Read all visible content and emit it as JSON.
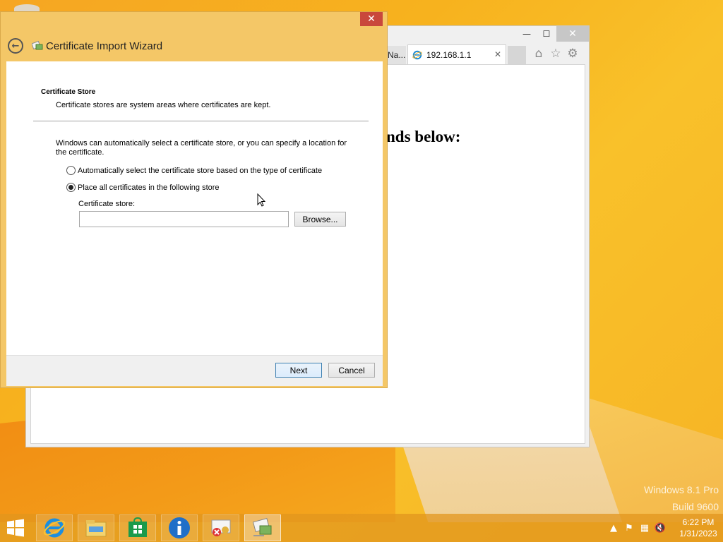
{
  "desktop": {
    "watermark_line1": "Windows 8.1 Pro",
    "watermark_line2": "Build 9600"
  },
  "browser": {
    "minimize": "—",
    "maximize": "☐",
    "close": "✕",
    "tab_prev_label": "Na...",
    "tab_active_label": "192.168.1.1",
    "tab_close": "✕",
    "page_heading_fragment": "nds below:"
  },
  "wizard": {
    "title": "Certificate Import Wizard",
    "close": "✕",
    "section_title": "Certificate Store",
    "section_desc": "Certificate stores are system areas where certificates are kept.",
    "intro": "Windows can automatically select a certificate store, or you can specify a location for the certificate.",
    "option_auto": "Automatically select the certificate store based on the type of certificate",
    "option_manual": "Place all certificates in the following store",
    "selected_option": "manual",
    "store_label": "Certificate store:",
    "store_value": "",
    "browse_label": "Browse...",
    "next_label": "Next",
    "cancel_label": "Cancel"
  },
  "taskbar": {
    "items": [
      "start-icon",
      "internet-explorer-icon",
      "file-explorer-icon",
      "store-icon",
      "info-icon",
      "certificate-error-icon",
      "certificate-wizard-icon"
    ],
    "time": "6:22 PM",
    "date": "1/31/2023"
  }
}
